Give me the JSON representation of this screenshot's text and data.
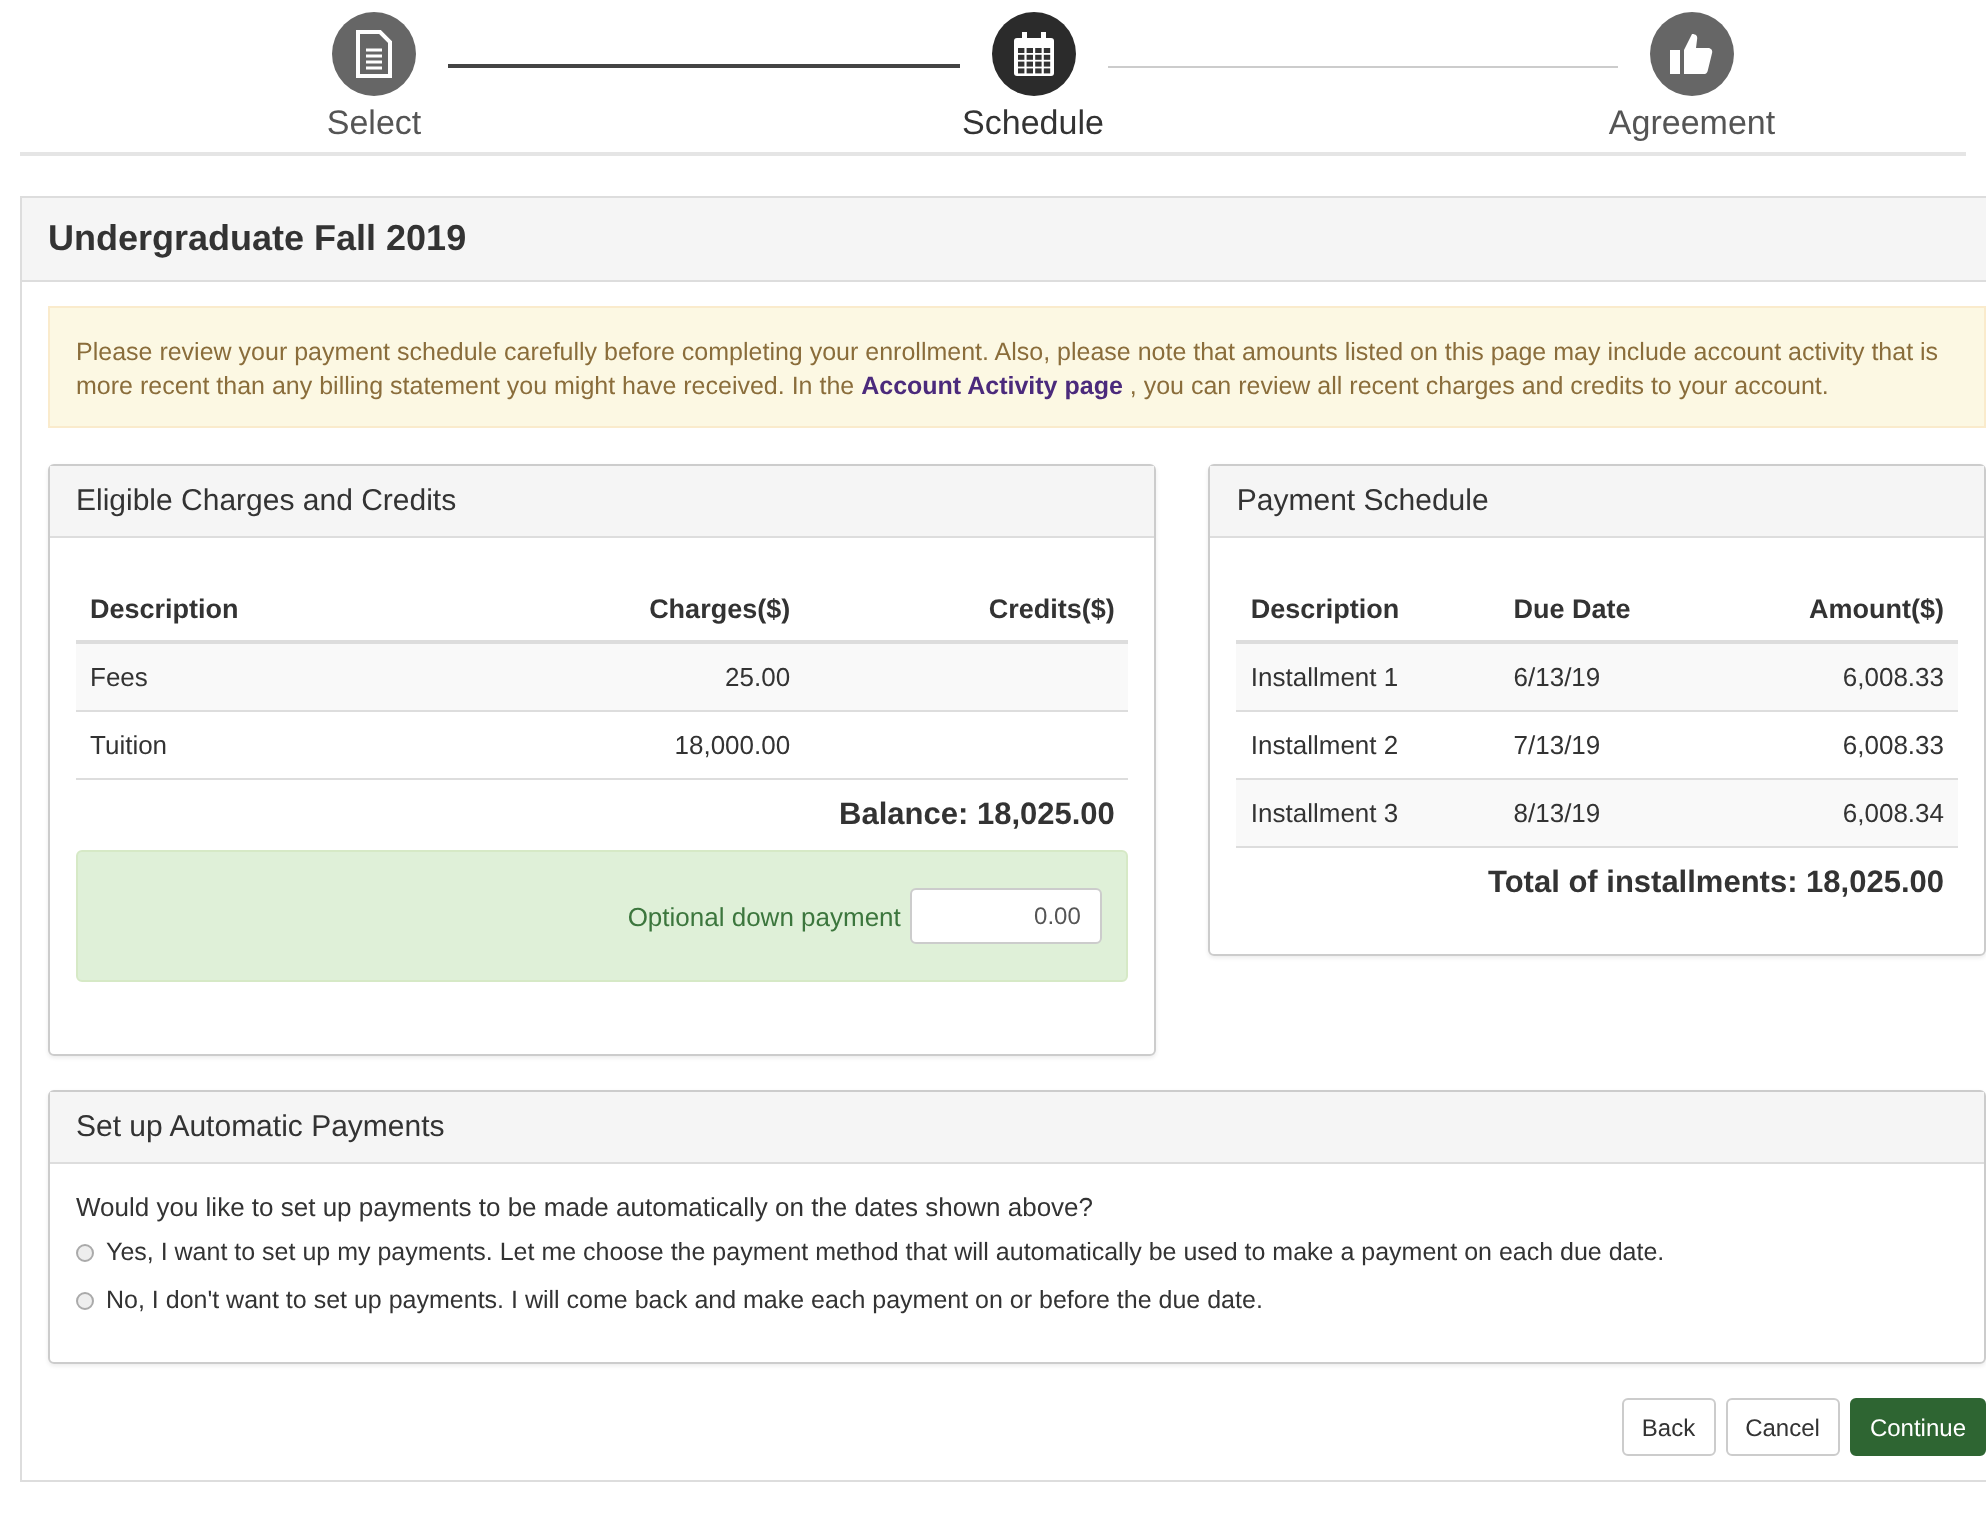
{
  "steps": [
    {
      "label": "Select",
      "kind": "document",
      "selected": false
    },
    {
      "label": "Schedule",
      "kind": "calendar",
      "selected": true
    },
    {
      "label": "Agreement",
      "kind": "thumbs-up",
      "selected": false
    }
  ],
  "panel": {
    "title": "Undergraduate Fall 2019"
  },
  "notice": {
    "text_before": "Please review your payment schedule carefully before completing your enrollment. Also, please note that amounts listed on this page may include account activity that is more recent than any billing statement you might have received. In the",
    "link": "Account Activity page",
    "text_after": ", you can review all recent charges and credits to your account."
  },
  "charges": {
    "title": "Eligible Charges and Credits",
    "columns": [
      "Description",
      "Charges($)",
      "Credits($)"
    ],
    "rows": [
      [
        "Fees",
        "25.00",
        ""
      ],
      [
        "Tuition",
        "18,000.00",
        ""
      ]
    ],
    "balance": "Balance: 18,025.00",
    "down_payment": {
      "label": "Optional down payment",
      "value": "0.00"
    }
  },
  "schedule": {
    "title": "Payment Schedule",
    "columns": [
      "Description",
      "Due Date",
      "Amount($)"
    ],
    "rows": [
      [
        "Installment 1",
        "6/13/19",
        "6,008.33"
      ],
      [
        "Installment 2",
        "7/13/19",
        "6,008.33"
      ],
      [
        "Installment 3",
        "8/13/19",
        "6,008.34"
      ]
    ],
    "total": "Total of installments: 18,025.00"
  },
  "auto_payments": {
    "title": "Set up Automatic Payments",
    "question": "Would you like to set up payments to be made automatically on the dates shown above?",
    "options": [
      {
        "label": "Yes, I want to set up my payments. Let me choose the payment method that will automatically be used to make a payment on each due date.",
        "selected": false
      },
      {
        "label": "No, I don't want to set up payments. I will come back and make each payment on or before the due date.",
        "selected": false
      }
    ]
  },
  "buttons": [
    {
      "label": "Back",
      "kind": "default"
    },
    {
      "label": "Cancel",
      "kind": "default"
    },
    {
      "label": "Continue",
      "kind": "primary"
    }
  ]
}
